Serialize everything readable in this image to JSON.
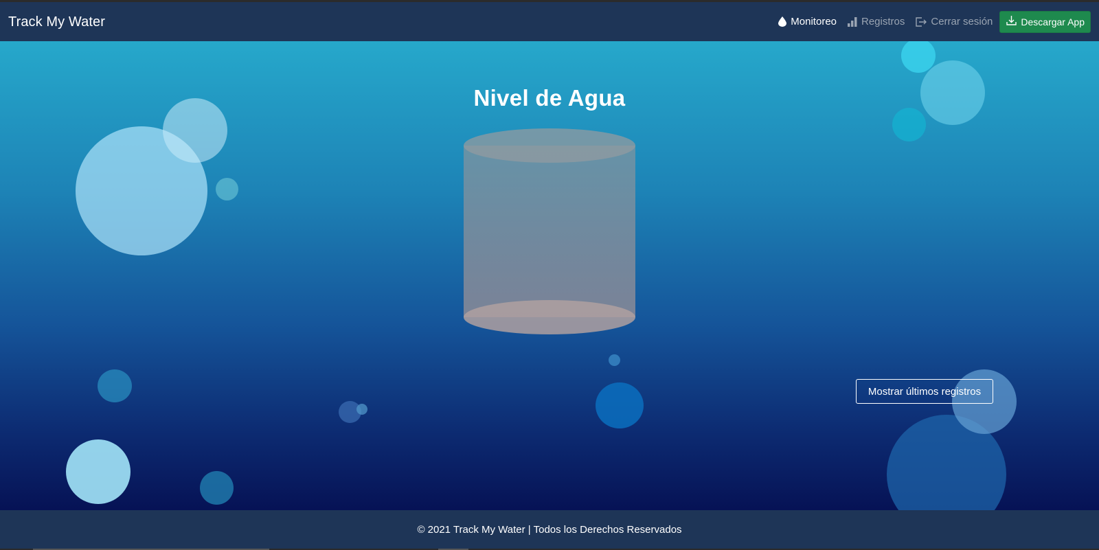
{
  "navbar": {
    "brand": "Track My Water",
    "links": [
      {
        "label": "Monitoreo",
        "icon": "water-drop-icon",
        "active": true
      },
      {
        "label": "Registros",
        "icon": "bar-chart-icon",
        "active": false
      },
      {
        "label": "Cerrar sesión",
        "icon": "logout-icon",
        "active": false
      }
    ],
    "download_label": "Descargar App"
  },
  "main": {
    "title": "Nivel de Agua",
    "records_button": "Mostrar últimos registros"
  },
  "footer": {
    "text": "© 2021 Track My Water | Todos los Derechos Reservados"
  },
  "colors": {
    "navbar_bg": "#1e3557",
    "download_btn": "#1e8a4e",
    "gradient_top": "#26a8cb",
    "gradient_bottom": "#061255"
  }
}
